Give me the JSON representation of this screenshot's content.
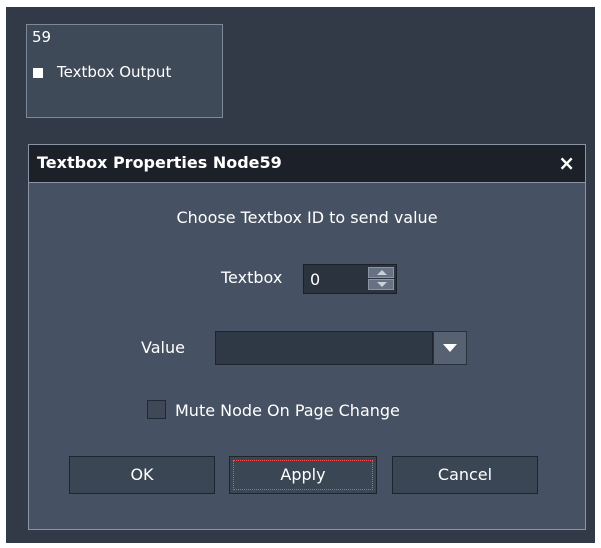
{
  "node": {
    "id": "59",
    "label": "Textbox Output"
  },
  "dialog": {
    "title": "Textbox Properties Node59",
    "close_label": "×",
    "instruction": "Choose Textbox ID to send value",
    "textbox_label": "Textbox",
    "textbox_value": "0",
    "value_label": "Value",
    "value_selected": "",
    "mute_label": "Mute Node On Page Change",
    "mute_checked": false,
    "buttons": {
      "ok": "OK",
      "apply": "Apply",
      "cancel": "Cancel"
    }
  },
  "icons": {
    "port": "port-square-icon",
    "close": "close-icon",
    "spin_up": "arrow-up-icon",
    "spin_down": "arrow-down-icon",
    "dropdown": "chevron-down-icon"
  },
  "colors": {
    "canvas": "#323a47",
    "dialog_bg": "#465263",
    "titlebar": "#1c2129",
    "focus_outline": "#ff4d4d"
  }
}
